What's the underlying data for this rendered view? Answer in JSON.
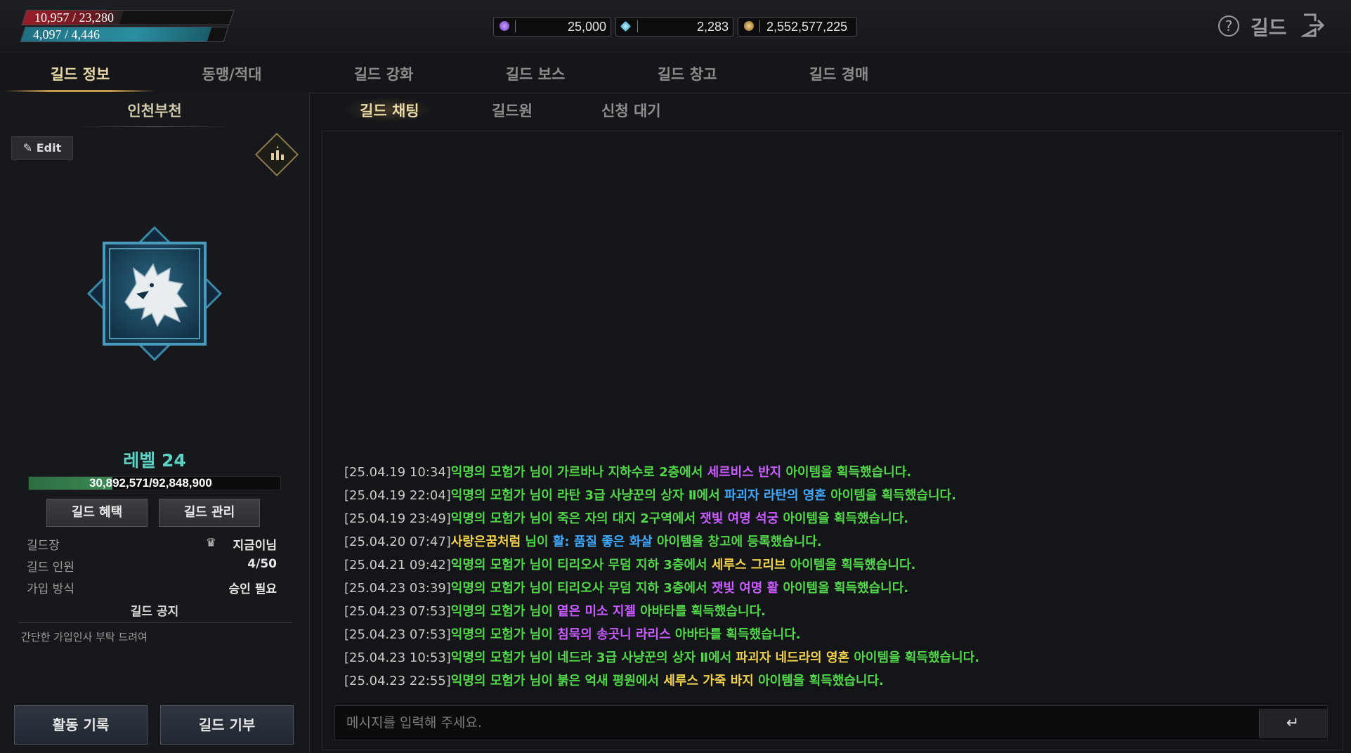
{
  "player": {
    "hp": "10,957 / 23,280",
    "hp_fraction": 0.47,
    "mp": "4,097 / 4,446",
    "mp_fraction": 0.92
  },
  "currency": [
    {
      "icon": "purple-gem-icon",
      "value": "25,000"
    },
    {
      "icon": "diamond-icon",
      "value": "2,283"
    },
    {
      "icon": "gold-coin-icon",
      "value": "2,552,577,225"
    }
  ],
  "header": {
    "title": "길드",
    "help_icon": "?"
  },
  "main_tabs": [
    "길드 정보",
    "동맹/적대",
    "길드 강화",
    "길드 보스",
    "길드 창고",
    "길드 경매"
  ],
  "guild": {
    "name": "인천부천",
    "edit_label": "Edit",
    "level": "레벨 24",
    "exp": "30,892,571/92,848,900",
    "exp_fraction": 0.333,
    "benefit_label": "길드 혜택",
    "manage_label": "길드 관리",
    "info": {
      "leader_key": "길드장",
      "leader_value": "지금이님",
      "members_key": "길드 인원",
      "members_value": "4/50",
      "join_key": "가입 방식",
      "join_value": "승인 필요"
    },
    "notice_title": "길드 공지",
    "notice_text": "간단한 가입인사 부탁 드려여",
    "activity_label": "활동 기록",
    "donate_label": "길드 기부"
  },
  "sub_tabs": [
    "길드 채팅",
    "길드원",
    "신청 대기"
  ],
  "chat": {
    "messages": [
      {
        "ts": "[25.04.19 10:34]",
        "parts": [
          [
            "g",
            "익명의 모험가 님이 가르바나 지하수로 2층에서 "
          ],
          [
            "p",
            "세르비스 반지"
          ],
          [
            "g",
            " 아이템을 획득했습니다."
          ]
        ]
      },
      {
        "ts": "[25.04.19 22:04]",
        "parts": [
          [
            "g",
            "익명의 모험가 님이 라탄 3급 사냥꾼의 상자 Ⅱ에서 "
          ],
          [
            "b",
            "파괴자 라탄의 영혼"
          ],
          [
            "g",
            " 아이템을 획득했습니다."
          ]
        ]
      },
      {
        "ts": "[25.04.19 23:49]",
        "parts": [
          [
            "g",
            "익명의 모험가 님이 죽은 자의 대지 2구역에서 "
          ],
          [
            "p",
            "잿빛 여명 석궁"
          ],
          [
            "g",
            " 아이템을 획득했습니다."
          ]
        ]
      },
      {
        "ts": "[25.04.20 07:47]",
        "parts": [
          [
            "y",
            "사랑은꿈처럼"
          ],
          [
            "g",
            " 님이 "
          ],
          [
            "b",
            " 활: 품질 좋은 화살"
          ],
          [
            "g",
            " 아이템을 창고에 등록했습니다."
          ]
        ]
      },
      {
        "ts": "[25.04.21 09:42]",
        "parts": [
          [
            "g",
            "익명의 모험가 님이 티리오사 무덤 지하 3층에서 "
          ],
          [
            "y",
            "세루스 그리브"
          ],
          [
            "g",
            " 아이템을 획득했습니다."
          ]
        ]
      },
      {
        "ts": "[25.04.23 03:39]",
        "parts": [
          [
            "g",
            "익명의 모험가 님이 티리오사 무덤 지하 3층에서 "
          ],
          [
            "p",
            "잿빛 여명 활"
          ],
          [
            "g",
            " 아이템을 획득했습니다."
          ]
        ]
      },
      {
        "ts": "[25.04.23 07:53]",
        "parts": [
          [
            "g",
            "익명의 모험가 님이 "
          ],
          [
            "p",
            "옅은 미소 지젤"
          ],
          [
            "g",
            " 아바타를 획득했습니다."
          ]
        ]
      },
      {
        "ts": "[25.04.23 07:53]",
        "parts": [
          [
            "g",
            "익명의 모험가 님이 "
          ],
          [
            "p",
            "침묵의 송곳니 라리스"
          ],
          [
            "g",
            " 아바타를 획득했습니다."
          ]
        ]
      },
      {
        "ts": "[25.04.23 10:53]",
        "parts": [
          [
            "g",
            "익명의 모험가 님이 네드라 3급 사냥꾼의 상자 Ⅱ에서 "
          ],
          [
            "y",
            "파괴자 네드라의 영혼"
          ],
          [
            "g",
            " 아이템을 획득했습니다."
          ]
        ]
      },
      {
        "ts": "[25.04.23 22:55]",
        "parts": [
          [
            "g",
            "익명의 모험가 님이 붉은 억새 평원에서 "
          ],
          [
            "y",
            "세루스 가죽 바지"
          ],
          [
            "g",
            " 아이템을 획득했습니다."
          ]
        ]
      }
    ],
    "input_placeholder": "메시지를 입력해 주세요.",
    "send_icon": "↵"
  },
  "colors": {
    "g": "#52d64a",
    "y": "#f2d24c",
    "p": "#c85cff",
    "b": "#3fa9ff",
    "accent": "#e9d9a8",
    "level": "#5fd2c6"
  }
}
